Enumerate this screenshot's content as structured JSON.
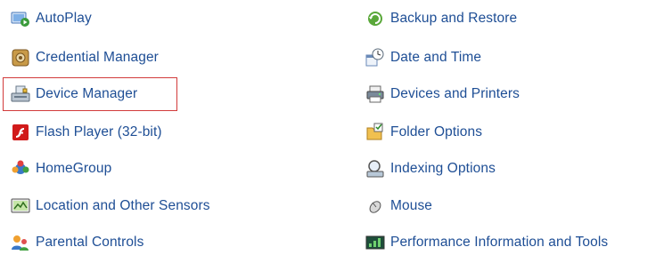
{
  "left_items": [
    {
      "label": "AutoPlay",
      "icon": "autoplay-icon"
    },
    {
      "label": "Credential Manager",
      "icon": "credential-manager-icon"
    },
    {
      "label": "Device Manager",
      "icon": "device-manager-icon"
    },
    {
      "label": "Flash Player (32-bit)",
      "icon": "flash-player-icon"
    },
    {
      "label": "HomeGroup",
      "icon": "homegroup-icon"
    },
    {
      "label": "Location and Other Sensors",
      "icon": "location-sensors-icon"
    },
    {
      "label": "Parental Controls",
      "icon": "parental-controls-icon"
    }
  ],
  "right_items": [
    {
      "label": "Backup and Restore",
      "icon": "backup-restore-icon"
    },
    {
      "label": "Date and Time",
      "icon": "date-time-icon"
    },
    {
      "label": "Devices and Printers",
      "icon": "devices-printers-icon"
    },
    {
      "label": "Folder Options",
      "icon": "folder-options-icon"
    },
    {
      "label": "Indexing Options",
      "icon": "indexing-options-icon"
    },
    {
      "label": "Mouse",
      "icon": "mouse-icon"
    },
    {
      "label": "Performance Information and Tools",
      "icon": "performance-tools-icon"
    }
  ],
  "colors": {
    "link": "#1e4e95",
    "highlight_border": "#d23b3b"
  }
}
